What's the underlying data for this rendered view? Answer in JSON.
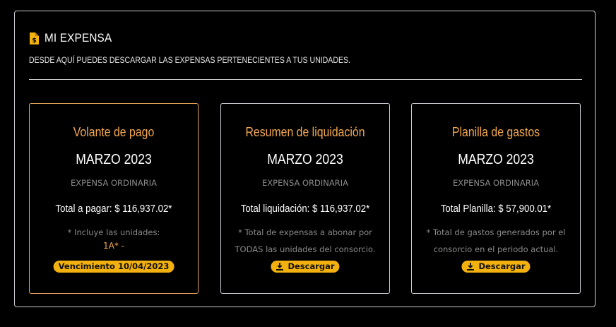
{
  "header": {
    "title": "MI EXPENSA",
    "subtitle": "DESDE AQUÍ PUEDES DESCARGAR LAS EXPENSAS PERTENECIENTES A TUS UNIDADES.",
    "icon": "receipt-document-icon"
  },
  "colors": {
    "accent": "#f4a84f",
    "badge": "#f2b10f",
    "muted": "#8a8a8a",
    "border": "#c9ccd1"
  },
  "cards": [
    {
      "title": "Volante de pago",
      "period": "MARZO 2023",
      "type": "EXPENSA ORDINARIA",
      "total": "Total a pagar: $ 116,937.02*",
      "note": "* Incluye las unidades:",
      "units": "1A* -",
      "badge": "Vencimiento 10/04/2023"
    },
    {
      "title": "Resumen de liquidación",
      "period": "MARZO 2023",
      "type": "EXPENSA ORDINARIA",
      "total": "Total liquidación: $ 116,937.02*",
      "note": "* Total de expensas a abonar por TODAS las unidades del consorcio.",
      "button": "Descargar"
    },
    {
      "title": "Planilla de gastos",
      "period": "MARZO 2023",
      "type": "EXPENSA ORDINARIA",
      "total": "Total Planilla: $ 57,900.01*",
      "note": "* Total de gastos generados por el consorcio en el periodo actual.",
      "button": "Descargar"
    }
  ]
}
